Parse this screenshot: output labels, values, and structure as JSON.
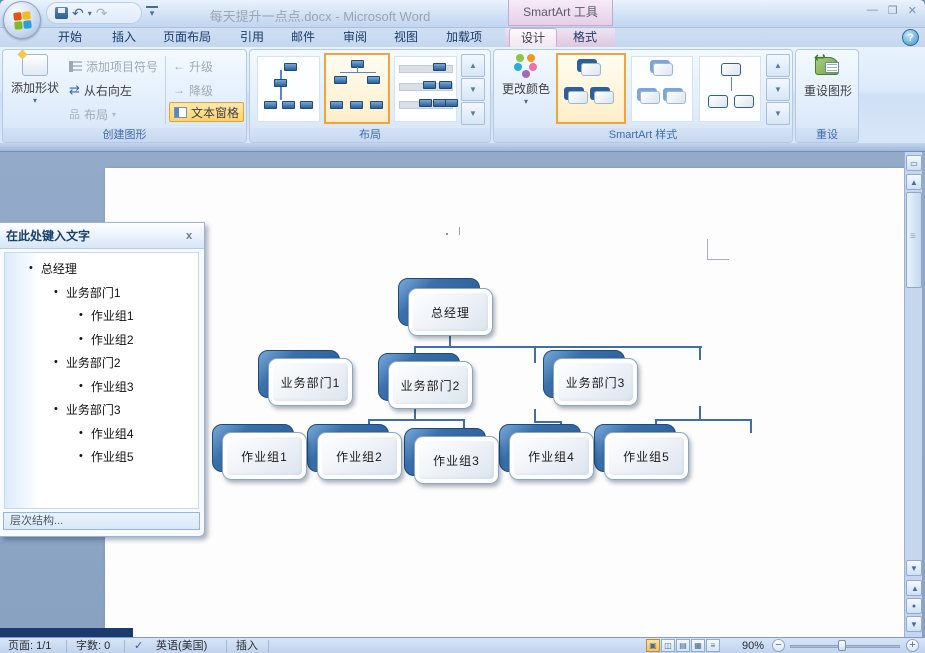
{
  "window": {
    "title": "每天提升一点点.docx - Microsoft Word",
    "tool_header": "SmartArt 工具"
  },
  "icons": {
    "close": "✕",
    "minimize": "—",
    "maximize": "❐",
    "help": "?",
    "dropdown": "▾",
    "up": "▲",
    "down": "▼",
    "more": "▼",
    "undo": "↶",
    "redo": "↷",
    "rtl": "⇄",
    "layout_glyph": "品",
    "arrow_left": "←",
    "arrow_right": "→",
    "reset_arrow": "↩",
    "bullet": "•",
    "check": "✓",
    "minus": "−",
    "plus": "+",
    "prev_page": "▲",
    "next_page": "▼",
    "browse": "●",
    "ruler": "▭",
    "grip": "⁞"
  },
  "ribbon": {
    "tabs": [
      "开始",
      "插入",
      "页面布局",
      "引用",
      "邮件",
      "审阅",
      "视图",
      "加载项",
      "设计",
      "格式"
    ],
    "active_tab": "设计",
    "create_group": {
      "label": "创建图形",
      "add_shape": "添加形状",
      "add_bullet": "添加项目符号",
      "right_to_left": "从右向左",
      "layout": "布局",
      "promote": "升级",
      "demote": "降级",
      "text_pane": "文本窗格"
    },
    "layout_group": {
      "label": "布局"
    },
    "styles_group": {
      "label": "SmartArt 样式",
      "change_colors": "更改颜色"
    },
    "reset_group": {
      "label": "重设",
      "reset_graphic": "重设图形"
    }
  },
  "text_pane": {
    "title": "在此处键入文字",
    "items": [
      {
        "label": "总经理",
        "level": 0
      },
      {
        "label": "业务部门1",
        "level": 1
      },
      {
        "label": "作业组1",
        "level": 2
      },
      {
        "label": "作业组2",
        "level": 2
      },
      {
        "label": "业务部门2",
        "level": 1
      },
      {
        "label": "作业组3",
        "level": 2
      },
      {
        "label": "业务部门3",
        "level": 1
      },
      {
        "label": "作业组4",
        "level": 2
      },
      {
        "label": "作业组5",
        "level": 2
      }
    ],
    "footer": "层次结构..."
  },
  "chart": {
    "nodes": [
      {
        "label": "总经理"
      },
      {
        "label": "业务部门1"
      },
      {
        "label": "业务部门2"
      },
      {
        "label": "业务部门3"
      },
      {
        "label": "作业组1"
      },
      {
        "label": "作业组2"
      },
      {
        "label": "作业组3"
      },
      {
        "label": "作业组4"
      },
      {
        "label": "作业组5"
      }
    ]
  },
  "status_bar": {
    "page": "页面: 1/1",
    "words": "字数: 0",
    "language": "英语(美国)",
    "mode": "插入",
    "zoom": "90%"
  },
  "colors": {
    "accent_blue": "#2d6097",
    "selection_orange": "#f0a43c",
    "text_pane_button": "#fdd36c"
  }
}
